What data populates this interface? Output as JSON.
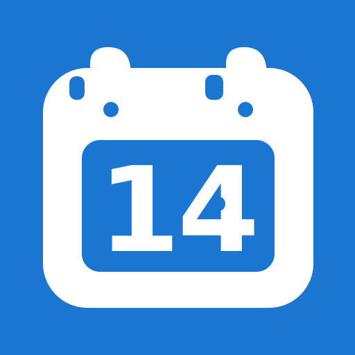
{
  "icon": {
    "name": "calendar-icon",
    "day_number": "14"
  },
  "colors": {
    "background": "#1b76d2",
    "foreground": "#ffffff"
  }
}
